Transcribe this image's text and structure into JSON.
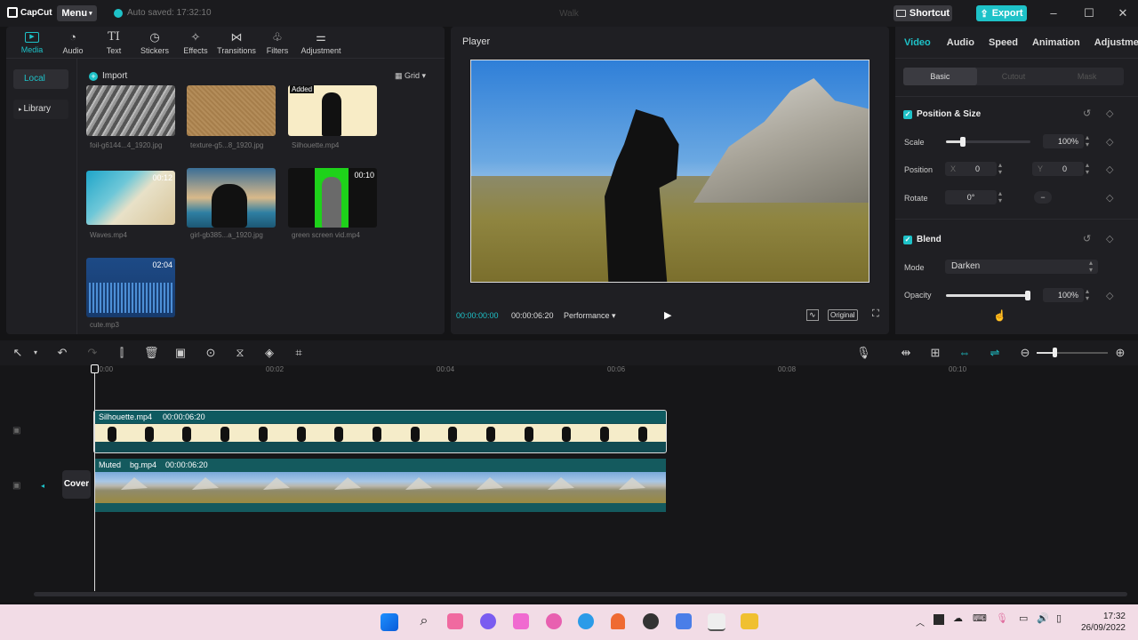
{
  "app": {
    "logo": "CapCut",
    "menu_label": "Menu",
    "autosave": "Auto saved: 17:32:10",
    "window_title": "Walk"
  },
  "titlebar": {
    "shortcut_label": "Shortcut",
    "export_label": "Export"
  },
  "media": {
    "tabs": [
      {
        "label": "Media",
        "icon": "media-icon"
      },
      {
        "label": "Audio",
        "icon": "audio-icon"
      },
      {
        "label": "Text",
        "icon": "text-icon"
      },
      {
        "label": "Stickers",
        "icon": "stickers-icon"
      },
      {
        "label": "Effects",
        "icon": "effects-icon"
      },
      {
        "label": "Transitions",
        "icon": "transitions-icon"
      },
      {
        "label": "Filters",
        "icon": "filters-icon"
      },
      {
        "label": "Adjustment",
        "icon": "adjustment-icon"
      }
    ],
    "side": {
      "local": "Local",
      "library": "Library"
    },
    "import_label": "Import",
    "grid_label": "Grid",
    "items": [
      {
        "name": "foil-g6144...4_1920.jpg",
        "badge": ""
      },
      {
        "name": "texture-g5...8_1920.jpg",
        "badge": ""
      },
      {
        "name": "Silhouette.mp4",
        "badge": "Added"
      },
      {
        "name": "Waves.mp4",
        "badge": "00:12"
      },
      {
        "name": "girl-gb385...a_1920.jpg",
        "badge": ""
      },
      {
        "name": "green screen vid.mp4",
        "badge": "00:10"
      },
      {
        "name": "cute.mp3",
        "badge": "02:04"
      }
    ]
  },
  "player": {
    "title": "Player",
    "current_time": "00:00:00:00",
    "total_time": "00:00:06:20",
    "performance_label": "Performance",
    "original_label": "Original"
  },
  "properties": {
    "tabs": [
      "Video",
      "Audio",
      "Speed",
      "Animation",
      "Adjustment"
    ],
    "subtabs": [
      "Basic",
      "Cutout",
      "Mask"
    ],
    "position_size": {
      "title": "Position & Size",
      "scale_label": "Scale",
      "scale_value": "100%",
      "scale_level": 0.2,
      "position_label": "Position",
      "x_label": "X",
      "x_value": "0",
      "y_label": "Y",
      "y_value": "0",
      "rotate_label": "Rotate",
      "rotate_value": "0°"
    },
    "blend": {
      "title": "Blend",
      "mode_label": "Mode",
      "mode_value": "Darken",
      "opacity_label": "Opacity",
      "opacity_value": "100%",
      "opacity_level": 1.0
    }
  },
  "timeline": {
    "ticks": [
      "00:00",
      "00:02",
      "00:04",
      "00:06",
      "00:08",
      "00:10"
    ],
    "track1": {
      "clip_name": "Silhouette.mp4",
      "duration": "00:00:06:20"
    },
    "track2": {
      "muted": "Muted",
      "clip_name": "bg.mp4",
      "duration": "00:00:06:20"
    },
    "cover_label": "Cover"
  },
  "taskbar": {
    "time": "17:32",
    "date": "26/09/2022"
  }
}
